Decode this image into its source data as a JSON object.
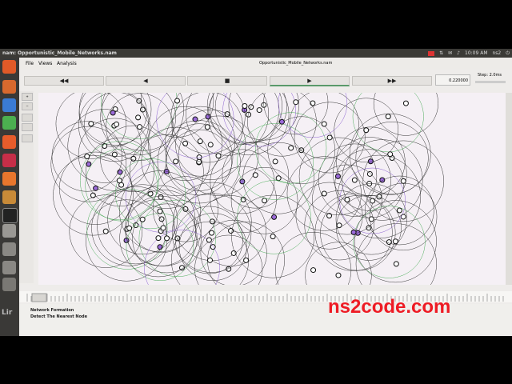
{
  "window": {
    "title": "nam: Opportunistic_Mobile_Networks.nam",
    "file_title": "Opportunistic_Mobile_Networks.nam",
    "clock": "10:09 AM",
    "user": "ns2"
  },
  "menu": {
    "file": "File",
    "views": "Views",
    "analysis": "Analysis"
  },
  "controls": {
    "rewind": "◀◀",
    "back": "◀",
    "stop": "■",
    "play": "▶",
    "fast_forward": "▶▶",
    "time": "0.220000",
    "step": "Step: 2.0ms"
  },
  "annotations": [
    "Network Formation",
    "Detect The Nearest Node"
  ],
  "watermark": "ns2code.com",
  "desktop_text": "Lir",
  "colors": {
    "accent": "#ee1b24",
    "topbar": "#3b3a36",
    "launcher": "#3a3937"
  }
}
